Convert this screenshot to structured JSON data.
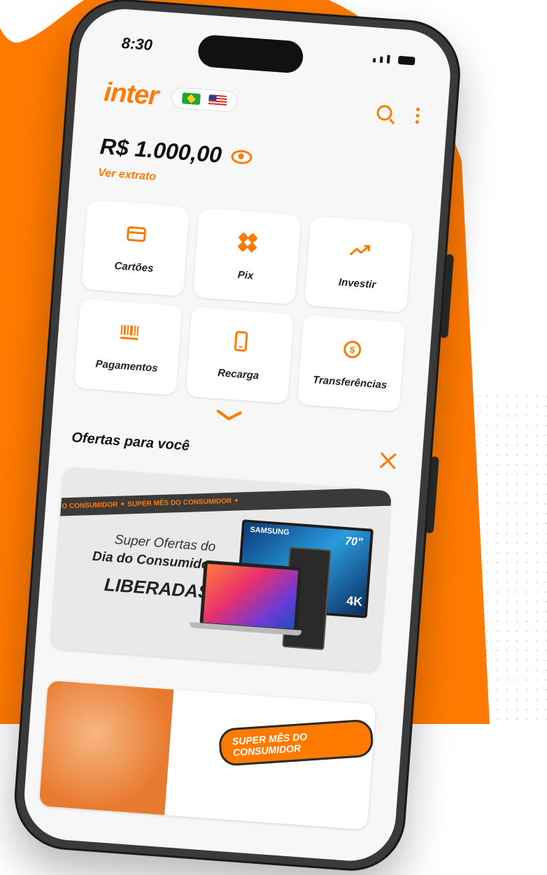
{
  "status_bar": {
    "time": "8:30"
  },
  "header": {
    "logo": "inter"
  },
  "account": {
    "balance": "R$ 1.000,00",
    "statement_link": "Ver extrato"
  },
  "shortcuts": [
    {
      "label": "Cartões",
      "icon": "card-icon"
    },
    {
      "label": "Pix",
      "icon": "pix-icon"
    },
    {
      "label": "Investir",
      "icon": "trend-up-icon"
    },
    {
      "label": "Pagamentos",
      "icon": "barcode-icon"
    },
    {
      "label": "Recarga",
      "icon": "phone-icon"
    },
    {
      "label": "Transferências",
      "icon": "money-transfer-icon"
    }
  ],
  "offers": {
    "title": "Ofertas para você",
    "banner": {
      "ribbon": "O CONSUMIDOR  ✦  SUPER MÊS DO CONSUMIDOR  ✦",
      "line1": "Super Ofertas do",
      "line2": "Dia do Consumidor",
      "line3": "LIBERADAS",
      "tv_brand": "SAMSUNG",
      "tv_size": "70\"",
      "tv_tag": "4K"
    },
    "second_banner": {
      "badge": "SUPER MÊS DO CONSUMIDOR"
    }
  },
  "colors": {
    "brand": "#ff7a00",
    "text": "#111111",
    "background": "#f7f7f7"
  }
}
